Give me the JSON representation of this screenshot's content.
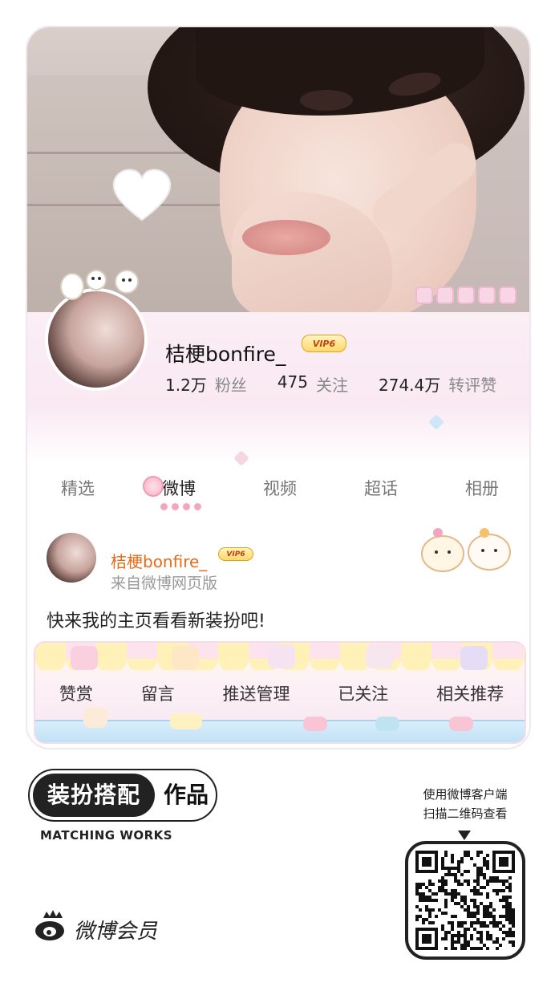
{
  "profile": {
    "name": "桔梗bonfire_",
    "vip": "VIP6",
    "stats": [
      {
        "value": "1.2万",
        "label": "粉丝"
      },
      {
        "value": "475",
        "label": "关注"
      },
      {
        "value": "274.4万",
        "label": "转评赞"
      }
    ]
  },
  "tabs": [
    "精选",
    "微博",
    "视频",
    "超话",
    "相册"
  ],
  "active_tab": "微博",
  "post": {
    "author": "桔梗bonfire_",
    "vip": "VIP6",
    "source": "来自微博网页版",
    "text": "快来我的主页看看新装扮吧!"
  },
  "actions": [
    "赞赏",
    "留言",
    "推送管理",
    "已关注",
    "相关推荐"
  ],
  "footer": {
    "badge_left": "装扮搭配",
    "badge_right": "作品",
    "badge_en": "MATCHING WORKS",
    "brand": "微博会员",
    "qr_caption_line1": "使用微博客户端",
    "qr_caption_line2": "扫描二维码查看"
  },
  "colors": {
    "accent_orange": "#e86b1a",
    "pink": "#f4a6bf",
    "vip_gold": "#ffd86a"
  }
}
